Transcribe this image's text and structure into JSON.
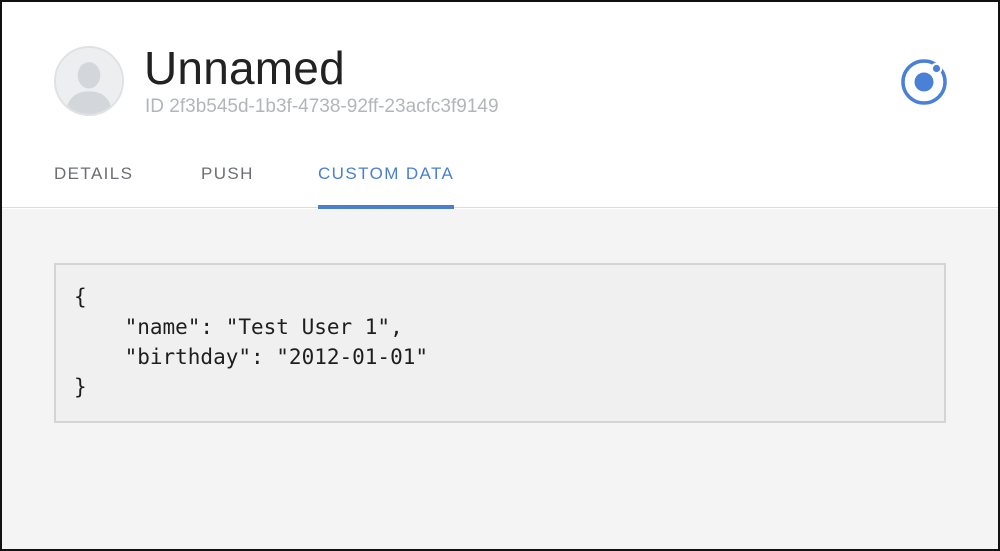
{
  "user": {
    "name": "Unnamed",
    "id_label": "ID 2f3b545d-1b3f-4738-92ff-23acfc3f9149"
  },
  "icons": {
    "avatar": "user-silhouette-icon",
    "logo": "ionic-logo-icon"
  },
  "tabs": [
    {
      "label": "DETAILS",
      "active": false
    },
    {
      "label": "PUSH",
      "active": false
    },
    {
      "label": "CUSTOM DATA",
      "active": true
    }
  ],
  "custom_data": {
    "lines": [
      "{",
      "    \"name\": \"Test User 1\",",
      "    \"birthday\": \"2012-01-01\"",
      "}"
    ]
  },
  "colors": {
    "accent": "#4a7fcf",
    "tab_inactive": "#6b6f73",
    "id_text": "#b2b6ba",
    "content_bg": "#f4f4f4"
  }
}
